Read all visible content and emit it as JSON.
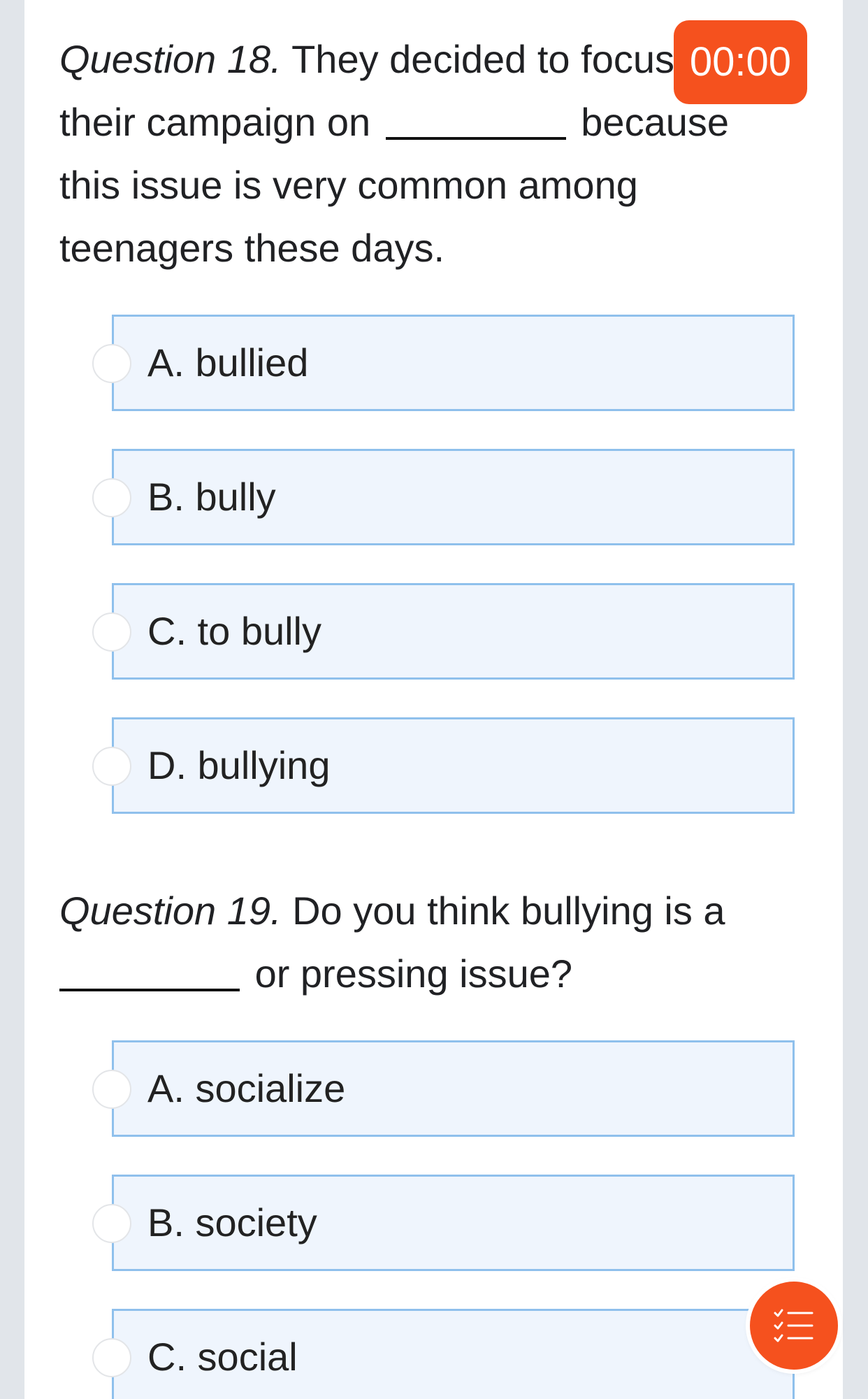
{
  "timer": {
    "value": "00:00"
  },
  "questions": [
    {
      "number": "Question 18.",
      "text_before": "They decided to focus",
      "text_line2": "their campaign on",
      "text_after": "because this issue is very common among teenagers these days.",
      "options": [
        "A. bullied",
        "B. bully",
        "C. to bully",
        "D. bullying"
      ]
    },
    {
      "number": "Question 19.",
      "text_before": "Do you think bullying is a",
      "text_after": "or pressing issue?",
      "options": [
        "A. socialize",
        "B. society",
        "C. social"
      ]
    }
  ],
  "colors": {
    "accent": "#f5511e",
    "option_bg": "#eff5fd",
    "option_border": "#8fc0ec"
  },
  "icons": {
    "fab": "question-list-icon"
  }
}
